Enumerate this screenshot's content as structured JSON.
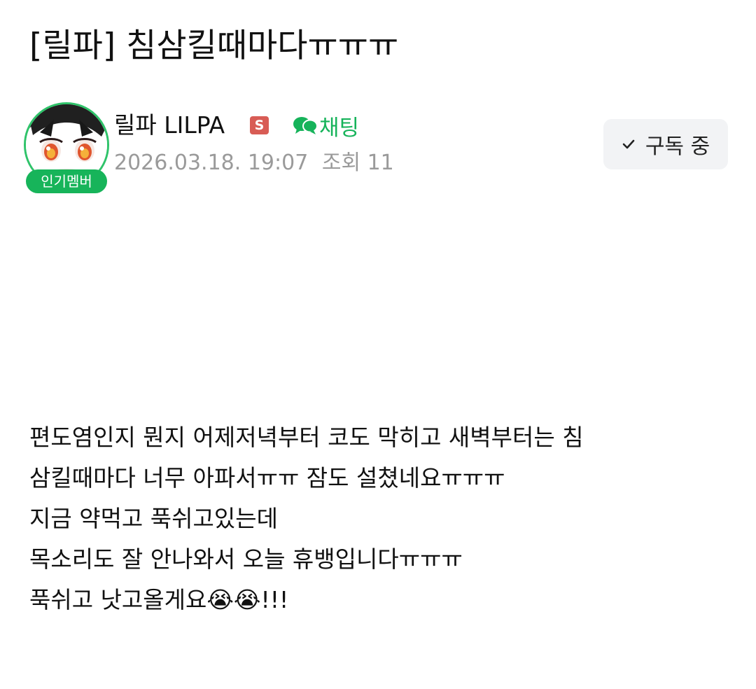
{
  "post": {
    "title": "[릴파] 침삼킬때마다ㅠㅠㅠ",
    "author": {
      "name": "릴파 LILPA",
      "staff_badge": "S",
      "level_badge": "인기멤버",
      "chat_label": "채팅"
    },
    "meta": {
      "date": "2026.03.18. 19:07",
      "views": "조회 11"
    },
    "subscribe_label": "구독 중",
    "body_lines": [
      "편도염인지 뭔지 어제저녁부터 코도 막히고 새벽부터는 침",
      "삼킬때마다 너무 아파서ㅠㅠ 잠도 설쳤네요ㅠㅠㅠ",
      "지금 약먹고 푹쉬고있는데",
      "목소리도 잘 안나와서 오늘 휴뱅입니다ㅠㅠㅠ",
      "푹쉬고 낫고올게요😭😭!!!"
    ]
  },
  "colors": {
    "accent_green": "#16b35a",
    "badge_green": "#17b45a",
    "staff_red": "#d85c55",
    "meta_gray": "#9a9a9a",
    "button_bg": "#f2f3f5"
  },
  "icons": {
    "chat": "chat-bubble-icon",
    "subscribe": "checkmark-icon"
  }
}
